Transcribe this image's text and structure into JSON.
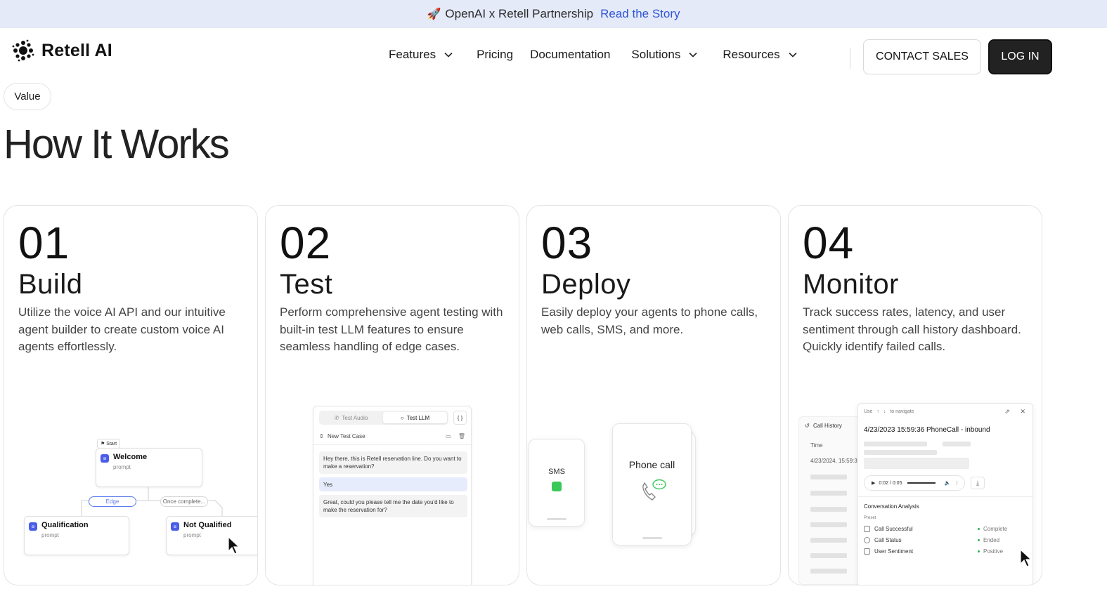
{
  "announcement": {
    "icon": "rocket-icon",
    "text": "OpenAI x Retell Partnership",
    "link": "Read the Story"
  },
  "header": {
    "logo_text": "Retell AI",
    "nav": [
      {
        "label": "Features",
        "dropdown": true
      },
      {
        "label": "Pricing",
        "dropdown": false
      },
      {
        "label": "Documentation",
        "dropdown": false
      },
      {
        "label": "Solutions",
        "dropdown": true
      },
      {
        "label": "Resources",
        "dropdown": true
      }
    ],
    "contact_label": "CONTACT SALES",
    "login_label": "LOG IN"
  },
  "section": {
    "pill": "Value",
    "heading": "How It Works"
  },
  "cards": [
    {
      "num": "01",
      "title": "Build",
      "desc": "Utilize the voice AI API and our intuitive agent builder to create custom voice AI agents effortlessly."
    },
    {
      "num": "02",
      "title": "Test",
      "desc": "Perform comprehensive agent testing with built-in test LLM features to ensure seamless handling of edge cases."
    },
    {
      "num": "03",
      "title": "Deploy",
      "desc": "Easily deploy your agents to phone calls, web calls, SMS, and more."
    },
    {
      "num": "04",
      "title": "Monitor",
      "desc": "Track success rates, latency, and user sentiment through call history dashboard. Quickly identify failed calls."
    }
  ],
  "build_flow": {
    "start": "Start",
    "welcome_title": "Welcome",
    "welcome_sub": "prompt",
    "edge": "Edge",
    "once": "Once complete...",
    "qual_title": "Qualification",
    "qual_sub": "prompt",
    "notqual_title": "Not Qualified",
    "notqual_sub": "prompt"
  },
  "test_panel": {
    "tab_audio": "Test Audio",
    "tab_llm": "Test LLM",
    "brace": "{ }",
    "case": "New Test Case",
    "msg1": "Hey there, this is Retell reservation line. Do you want to make a reservation?",
    "msg2": "Yes",
    "msg3": "Great, could you please tell me the date you'd like to make the reservation for?"
  },
  "deploy": {
    "sms": "SMS",
    "phone": "Phone call"
  },
  "monitor": {
    "history_title": "Call History",
    "time_col": "Time",
    "first_date": "4/23/2024, 15:59:3",
    "nav_hint_use": "Use",
    "nav_hint_to": "to navigate",
    "call_title": "4/23/2023 15:59:36 PhoneCall - inbound",
    "audio_time": "0:02 / 0:05",
    "analysis": "Conversation Analysis",
    "preset": "Preset",
    "rows": [
      {
        "label": "Call Successful",
        "status": "Complete"
      },
      {
        "label": "Call Status",
        "status": "Ended"
      },
      {
        "label": "User Sentiment",
        "status": "Positive"
      }
    ]
  },
  "colors": {
    "announce_bg": "#e5eaf8",
    "link": "#2f55d4",
    "accent_blue": "#4a5ee8",
    "sms_green": "#3ac85a",
    "login_bg": "#222222"
  }
}
